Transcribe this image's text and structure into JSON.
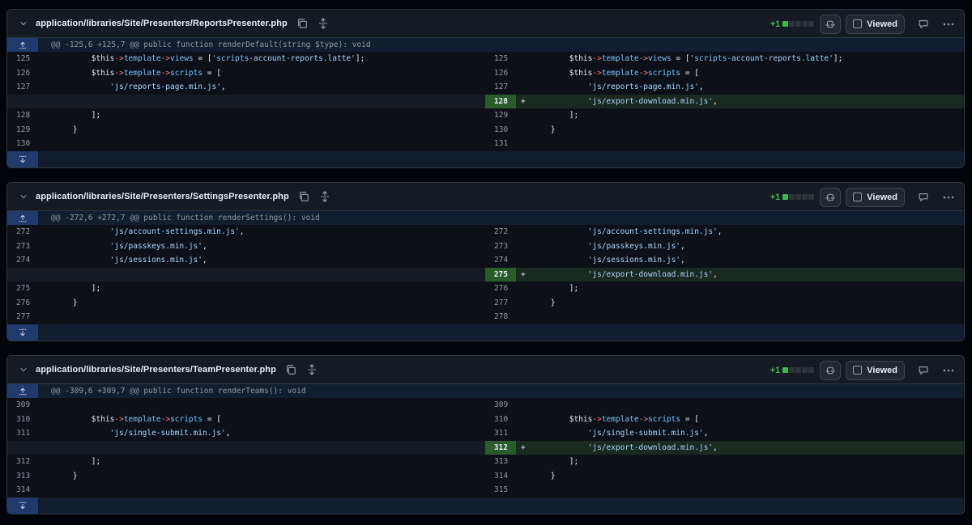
{
  "colors": {
    "added": "#3fb950",
    "hunk_bg": "#121d2f",
    "expander_bg": "#1f3a6b"
  },
  "files": [
    {
      "path": "application/libraries/Site/Presenters/ReportsPresenter.php",
      "diffstat": "+1",
      "viewed_label": "Viewed",
      "hunk": "@@ -125,6 +125,7 @@ public function renderDefault(string $type): void",
      "left": [
        {
          "ln": "125",
          "code": "        $this->template->views = ['scripts-account-reports.latte'];"
        },
        {
          "ln": "126",
          "code": "        $this->template->scripts = ["
        },
        {
          "ln": "127",
          "code": "            'js/reports-page.min.js',"
        },
        {
          "ln": "",
          "code": ""
        },
        {
          "ln": "128",
          "code": "        ];"
        },
        {
          "ln": "129",
          "code": "    }"
        },
        {
          "ln": "130",
          "code": ""
        }
      ],
      "right": [
        {
          "ln": "125",
          "code": "        $this->template->views = ['scripts-account-reports.latte'];"
        },
        {
          "ln": "126",
          "code": "        $this->template->scripts = ["
        },
        {
          "ln": "127",
          "code": "            'js/reports-page.min.js',"
        },
        {
          "ln": "128",
          "code": "            'js/export-download.min.js',",
          "sign": "+"
        },
        {
          "ln": "129",
          "code": "        ];"
        },
        {
          "ln": "130",
          "code": "    }"
        },
        {
          "ln": "131",
          "code": ""
        }
      ]
    },
    {
      "path": "application/libraries/Site/Presenters/SettingsPresenter.php",
      "diffstat": "+1",
      "viewed_label": "Viewed",
      "hunk": "@@ -272,6 +272,7 @@ public function renderSettings(): void",
      "left": [
        {
          "ln": "272",
          "code": "            'js/account-settings.min.js',"
        },
        {
          "ln": "273",
          "code": "            'js/passkeys.min.js',"
        },
        {
          "ln": "274",
          "code": "            'js/sessions.min.js',"
        },
        {
          "ln": "",
          "code": ""
        },
        {
          "ln": "275",
          "code": "        ];"
        },
        {
          "ln": "276",
          "code": "    }"
        },
        {
          "ln": "277",
          "code": ""
        }
      ],
      "right": [
        {
          "ln": "272",
          "code": "            'js/account-settings.min.js',"
        },
        {
          "ln": "273",
          "code": "            'js/passkeys.min.js',"
        },
        {
          "ln": "274",
          "code": "            'js/sessions.min.js',"
        },
        {
          "ln": "275",
          "code": "            'js/export-download.min.js',",
          "sign": "+"
        },
        {
          "ln": "276",
          "code": "        ];"
        },
        {
          "ln": "277",
          "code": "    }"
        },
        {
          "ln": "278",
          "code": ""
        }
      ]
    },
    {
      "path": "application/libraries/Site/Presenters/TeamPresenter.php",
      "diffstat": "+1",
      "viewed_label": "Viewed",
      "hunk": "@@ -309,6 +309,7 @@ public function renderTeams(): void",
      "left": [
        {
          "ln": "309",
          "code": ""
        },
        {
          "ln": "310",
          "code": "        $this->template->scripts = ["
        },
        {
          "ln": "311",
          "code": "            'js/single-submit.min.js',"
        },
        {
          "ln": "",
          "code": ""
        },
        {
          "ln": "312",
          "code": "        ];"
        },
        {
          "ln": "313",
          "code": "    }"
        },
        {
          "ln": "314",
          "code": ""
        }
      ],
      "right": [
        {
          "ln": "309",
          "code": ""
        },
        {
          "ln": "310",
          "code": "        $this->template->scripts = ["
        },
        {
          "ln": "311",
          "code": "            'js/single-submit.min.js',"
        },
        {
          "ln": "312",
          "code": "            'js/export-download.min.js',",
          "sign": "+"
        },
        {
          "ln": "313",
          "code": "        ];"
        },
        {
          "ln": "314",
          "code": "    }"
        },
        {
          "ln": "315",
          "code": ""
        }
      ]
    }
  ]
}
